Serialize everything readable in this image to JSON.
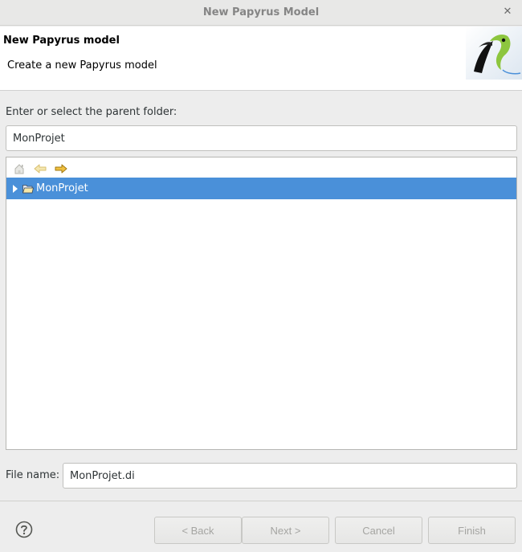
{
  "window": {
    "title": "New Papyrus Model",
    "close_glyph": "✕"
  },
  "banner": {
    "heading": "New Papyrus model",
    "description": "Create a new Papyrus model",
    "logo_icon": "papyrus-bird-logo"
  },
  "parent_folder": {
    "label": "Enter or select the parent folder:",
    "value": "MonProjet"
  },
  "tree": {
    "toolbar": [
      {
        "icon": "home-icon",
        "enabled": false
      },
      {
        "icon": "back-arrow-icon",
        "enabled": false
      },
      {
        "icon": "forward-arrow-icon",
        "enabled": true
      }
    ],
    "items": [
      {
        "label": "MonProjet",
        "selected": true,
        "expanded": false,
        "icon": "open-folder-icon"
      }
    ]
  },
  "file_name": {
    "label": "File name:",
    "value": "MonProjet.di"
  },
  "footer": {
    "help_icon": "help-icon",
    "back_label": "< Back",
    "next_label": "Next >",
    "cancel_label": "Cancel",
    "finish_label": "Finish"
  },
  "colors": {
    "selection": "#4a90d9",
    "accent_yellow": "#f0c040",
    "logo_green": "#8dc63f"
  }
}
